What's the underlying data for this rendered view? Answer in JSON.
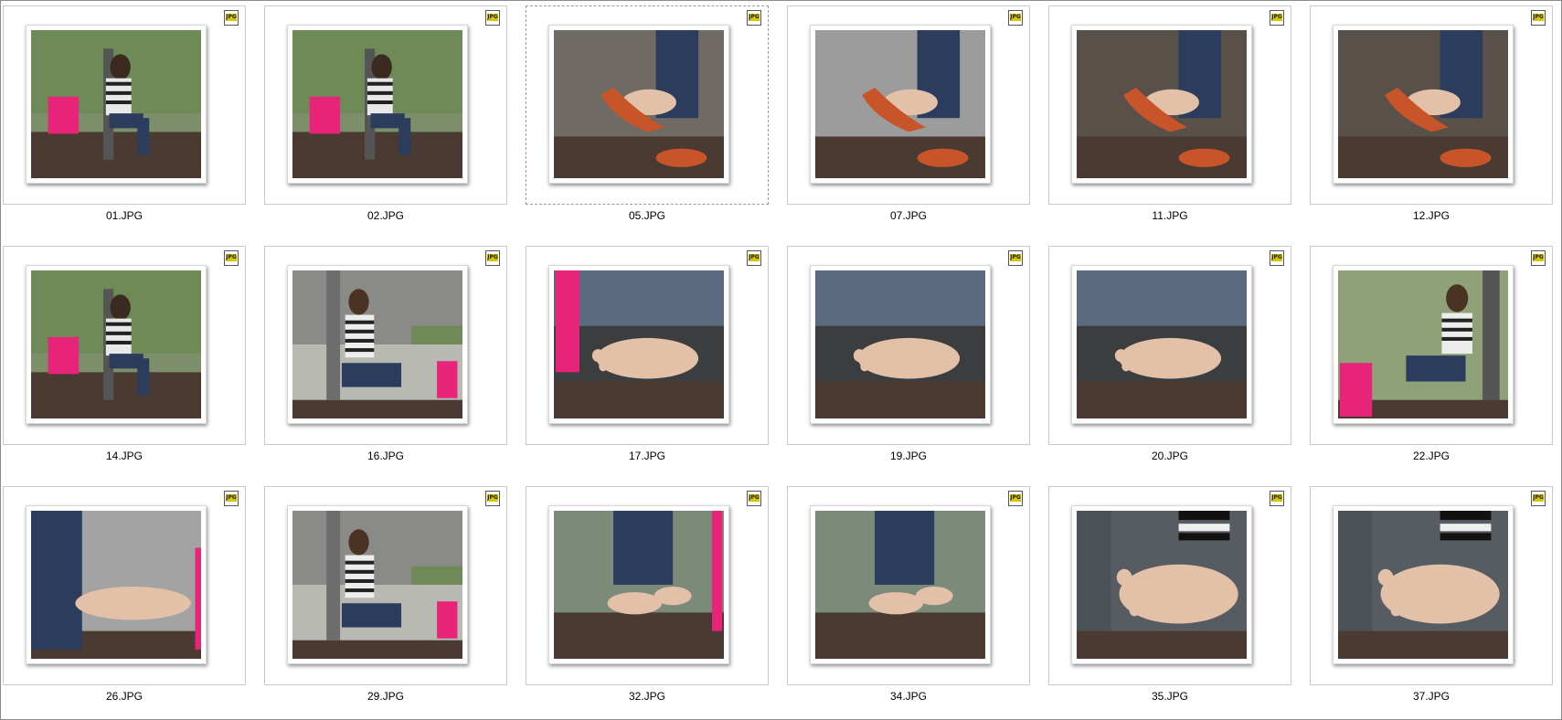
{
  "window": {
    "title": ""
  },
  "badge_text": "JPG",
  "files": [
    {
      "name": "01.JPG",
      "scene": "sitting-bench-bag",
      "selected": false
    },
    {
      "name": "02.JPG",
      "scene": "sitting-bench-bag",
      "selected": false
    },
    {
      "name": "05.JPG",
      "scene": "shoe-dangle-dark",
      "selected": true
    },
    {
      "name": "07.JPG",
      "scene": "shoe-dangle-grey",
      "selected": false
    },
    {
      "name": "11.JPG",
      "scene": "shoe-dangle-bench",
      "selected": false
    },
    {
      "name": "12.JPG",
      "scene": "shoe-dangle-bench",
      "selected": false
    },
    {
      "name": "14.JPG",
      "scene": "sitting-bench-bag",
      "selected": false
    },
    {
      "name": "16.JPG",
      "scene": "sitting-floor-bag",
      "selected": false
    },
    {
      "name": "17.JPG",
      "scene": "sole-closeup-pinkbag",
      "selected": false
    },
    {
      "name": "19.JPG",
      "scene": "sole-closeup",
      "selected": false
    },
    {
      "name": "20.JPG",
      "scene": "sole-closeup",
      "selected": false
    },
    {
      "name": "22.JPG",
      "scene": "sitting-floor-bag-left",
      "selected": false
    },
    {
      "name": "26.JPG",
      "scene": "foot-side-grey",
      "selected": false
    },
    {
      "name": "29.JPG",
      "scene": "sitting-floor-bag",
      "selected": false
    },
    {
      "name": "32.JPG",
      "scene": "feet-bench-pink",
      "selected": false
    },
    {
      "name": "34.JPG",
      "scene": "feet-bench",
      "selected": false
    },
    {
      "name": "35.JPG",
      "scene": "sole-closeup-stripes",
      "selected": false
    },
    {
      "name": "37.JPG",
      "scene": "sole-closeup-stripes",
      "selected": false
    }
  ],
  "colors": {
    "pink_bag": "#e8247a",
    "jeans": "#2b3c5c",
    "shoe": "#c8542a",
    "bench": "#4a3a32",
    "skin": "#e3c0a8",
    "greenery": "#6e8a56"
  }
}
